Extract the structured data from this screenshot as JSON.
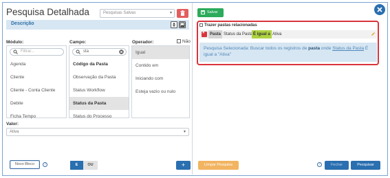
{
  "title": "Pesquisa Detalhada",
  "saved_searches": {
    "placeholder": "Pesquisas Salvas"
  },
  "description": {
    "label": "Descrição"
  },
  "modulo": {
    "label": "Módulo:",
    "search_placeholder": "Filtrar...",
    "items": [
      "Agenda",
      "Cliente",
      "Cliente - Conta Cliente",
      "Debite",
      "Ficha Tempo"
    ]
  },
  "campo": {
    "label": "Campo:",
    "search_value": "sta",
    "items": [
      "Código da Pasta",
      "Observação da Pasta",
      "Status Workflow",
      "Status da Pasta",
      "Status do Processo"
    ]
  },
  "operador": {
    "label": "Operador:",
    "nao_label": "Não",
    "items": [
      "Igual",
      "Contido em",
      "Iniciando com",
      "Esteja vazio ou nulo"
    ]
  },
  "valor": {
    "label": "Valor:",
    "selected": "Ativa"
  },
  "buttons": {
    "novo_bloco": "Novo Bloco",
    "e": "E",
    "ou": "OU",
    "plus": "+",
    "salvar": "Salvar",
    "limpar": "Limpar Pesquisa",
    "fechar": "Fechar",
    "pesquisar": "Pesquisar",
    "help": "?"
  },
  "right": {
    "trazer_label": "Trazer pastas relacionadas",
    "filter": {
      "x": "×",
      "modulo": "Pasta",
      "campo": "Status da Pasta",
      "operador": "É igual a",
      "valor": "Ativa"
    },
    "summary": {
      "p1": "Pesquisa Selecionada: Buscar todos os registros de ",
      "p2": "pasta",
      "p3": " onde ",
      "p4": "Status da Pasta",
      "p5": " É igual a \"Ativa\""
    }
  },
  "colors": {
    "primary": "#2a6fb0",
    "success": "#2bab5b",
    "danger": "#d9333c",
    "warning": "#f2b461",
    "operator_pill": "#aed241"
  }
}
